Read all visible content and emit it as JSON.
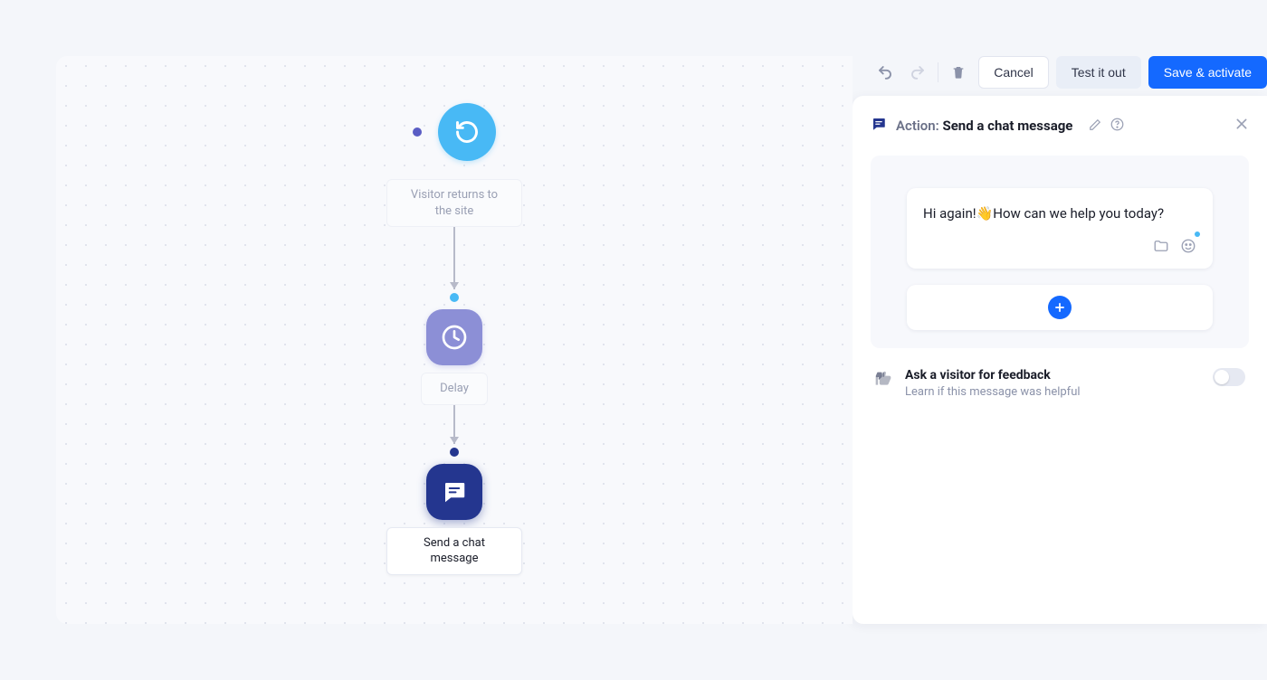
{
  "toolbar": {
    "cancel_label": "Cancel",
    "test_label": "Test it out",
    "save_label": "Save & activate"
  },
  "flow": {
    "trigger_label": "Visitor returns to the site",
    "delay_label": "Delay",
    "action_label": "Send a chat message"
  },
  "panel": {
    "header_label": "Action:",
    "header_value": "Send a chat message",
    "message_text_pre": "Hi again!",
    "message_emoji": "👋",
    "message_text_post": "How can we help you today?",
    "feedback_title": "Ask a visitor for feedback",
    "feedback_subtitle": "Learn if this message was helpful"
  }
}
